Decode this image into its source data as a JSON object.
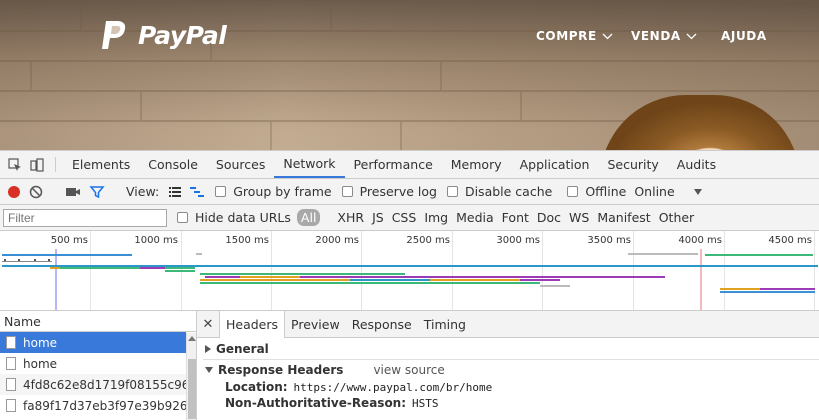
{
  "site": {
    "logo_text": "PayPal",
    "nav": [
      {
        "label": "COMPRE",
        "has_dropdown": true
      },
      {
        "label": "VENDA",
        "has_dropdown": true
      },
      {
        "label": "AJUDA",
        "has_dropdown": false
      }
    ]
  },
  "devtools": {
    "tabs": [
      "Elements",
      "Console",
      "Sources",
      "Network",
      "Performance",
      "Memory",
      "Application",
      "Security",
      "Audits"
    ],
    "active_tab": "Network",
    "toolbar": {
      "view_label": "View:",
      "group_by_frame": "Group by frame",
      "preserve_log": "Preserve log",
      "disable_cache": "Disable cache",
      "offline": "Offline",
      "throttle": "Online"
    },
    "filter": {
      "placeholder": "Filter",
      "hide_data_urls": "Hide data URLs",
      "types": [
        "All",
        "XHR",
        "JS",
        "CSS",
        "Img",
        "Media",
        "Font",
        "Doc",
        "WS",
        "Manifest",
        "Other"
      ],
      "active_type": "All"
    },
    "timeline": {
      "ticks": [
        "500 ms",
        "1000 ms",
        "1500 ms",
        "2000 ms",
        "2500 ms",
        "3000 ms",
        "3500 ms",
        "4000 ms",
        "4500 ms"
      ]
    },
    "requests": {
      "header": "Name",
      "rows": [
        "home",
        "home",
        "4fd8c62e8d1719f08155c965...",
        "fa89f17d37eb3f97e39b9268..."
      ],
      "selected_index": 0
    },
    "details": {
      "tabs": [
        "Headers",
        "Preview",
        "Response",
        "Timing"
      ],
      "active_tab": "Headers",
      "general_label": "General",
      "response_headers_label": "Response Headers",
      "view_source": "view source",
      "headers": [
        {
          "name": "Location:",
          "value": "https://www.paypal.com/br/home"
        },
        {
          "name": "Non-Authoritative-Reason:",
          "value": "HSTS"
        }
      ]
    }
  },
  "colors": {
    "accent": "#3879d9",
    "record": "#d93025",
    "filter_active": "#1a73e8"
  }
}
